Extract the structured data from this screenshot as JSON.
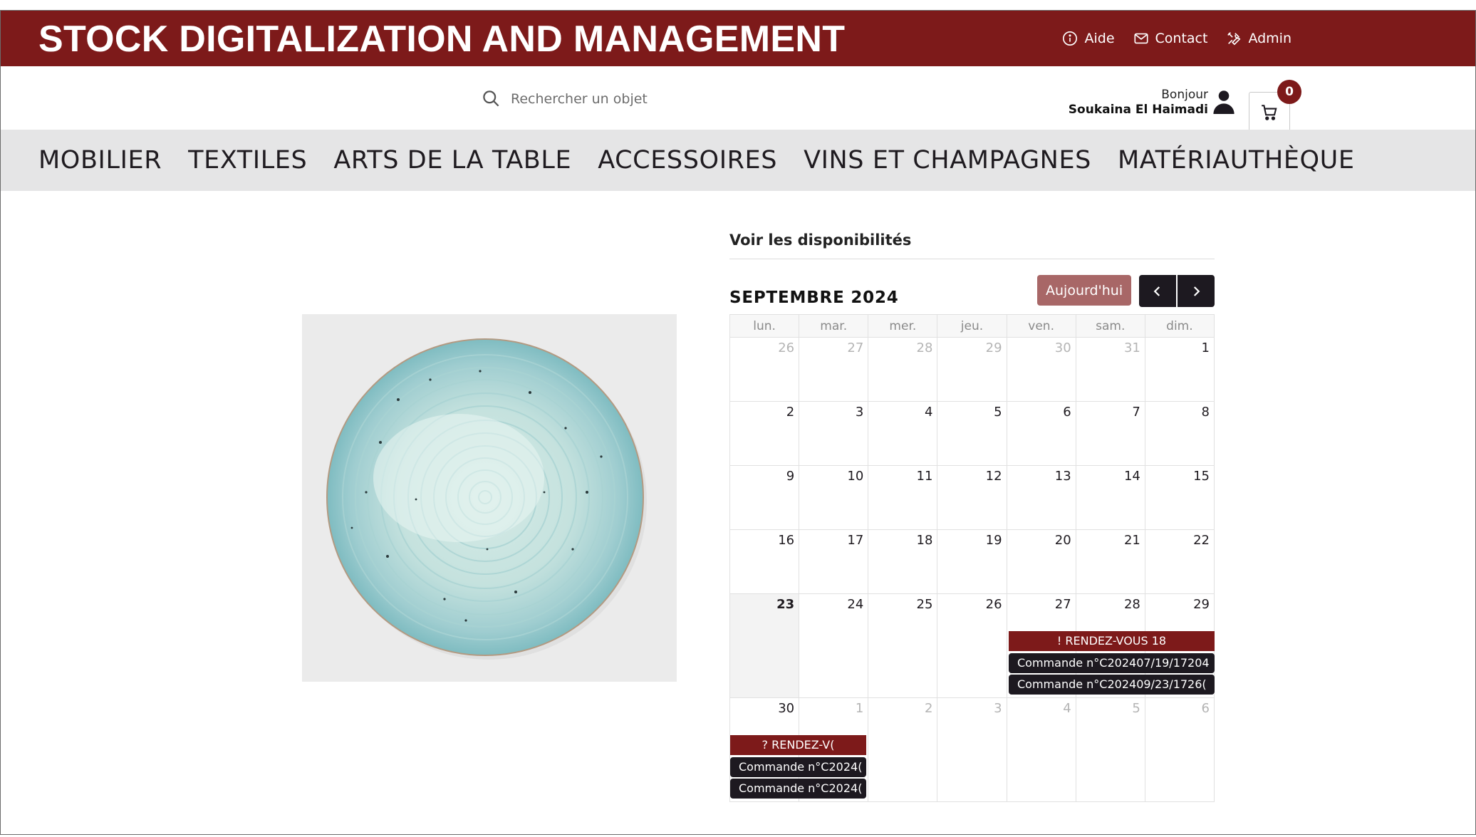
{
  "header": {
    "title": "STOCK DIGITALIZATION AND MANAGEMENT",
    "links": [
      {
        "label": "Aide",
        "icon": "info-icon"
      },
      {
        "label": "Contact",
        "icon": "mail-icon"
      },
      {
        "label": "Admin",
        "icon": "tools-icon"
      }
    ]
  },
  "search": {
    "placeholder": "Rechercher un objet"
  },
  "user": {
    "greeting": "Bonjour",
    "name": "Soukaina El Haimadi"
  },
  "cart": {
    "count": "0"
  },
  "categories": [
    "MOBILIER",
    "TEXTILES",
    "ARTS DE LA TABLE",
    "ACCESSOIRES",
    "VINS ET CHAMPAGNES",
    "MATÉRIAUTHÈQUE"
  ],
  "calendar": {
    "heading": "Voir les disponibilités",
    "month": "SEPTEMBRE 2024",
    "today_label": "Aujourd'hui",
    "weekdays": [
      "lun.",
      "mar.",
      "mer.",
      "jeu.",
      "ven.",
      "sam.",
      "dim."
    ],
    "weeks": [
      [
        "26",
        "27",
        "28",
        "29",
        "30",
        "31",
        "1"
      ],
      [
        "2",
        "3",
        "4",
        "5",
        "6",
        "7",
        "8"
      ],
      [
        "9",
        "10",
        "11",
        "12",
        "13",
        "14",
        "15"
      ],
      [
        "16",
        "17",
        "18",
        "19",
        "20",
        "21",
        "22"
      ],
      [
        "23",
        "24",
        "25",
        "26",
        "27",
        "28",
        "29"
      ],
      [
        "30",
        "1",
        "2",
        "3",
        "4",
        "5",
        "6"
      ]
    ],
    "events": {
      "week5_rdv": "! RENDEZ-VOUS 18",
      "week5_cmd1": "Commande n°C202407/19/17204",
      "week5_cmd2": "Commande n°C202409/23/1726(",
      "week6_rdv": "? RENDEZ-V(",
      "week6_cmd1": "Commande n°C2024(",
      "week6_cmd2": "Commande n°C2024("
    }
  },
  "colors": {
    "brand": "#7d1a1a",
    "today_button": "#a86767",
    "dark": "#1d1920",
    "nav_bg": "#e5e5e6"
  }
}
